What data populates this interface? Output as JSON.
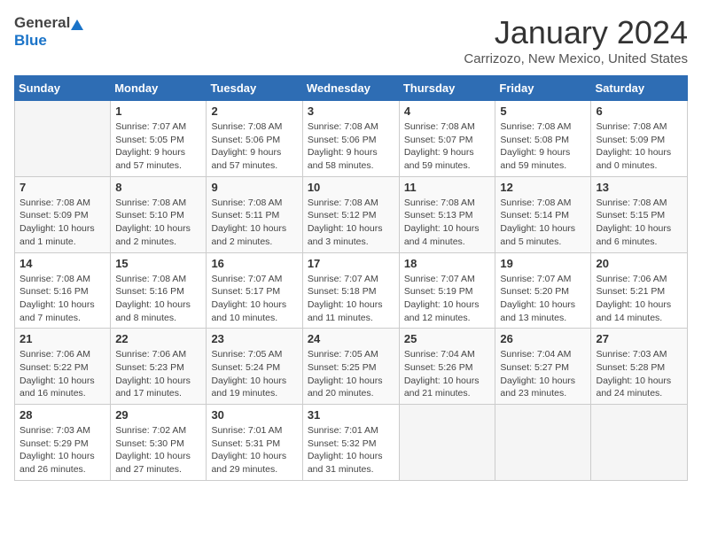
{
  "logo": {
    "general": "General",
    "blue": "Blue"
  },
  "header": {
    "month": "January 2024",
    "location": "Carrizozo, New Mexico, United States"
  },
  "days_of_week": [
    "Sunday",
    "Monday",
    "Tuesday",
    "Wednesday",
    "Thursday",
    "Friday",
    "Saturday"
  ],
  "weeks": [
    [
      {
        "num": "",
        "sunrise": "",
        "sunset": "",
        "daylight": ""
      },
      {
        "num": "1",
        "sunrise": "Sunrise: 7:07 AM",
        "sunset": "Sunset: 5:05 PM",
        "daylight": "Daylight: 9 hours and 57 minutes."
      },
      {
        "num": "2",
        "sunrise": "Sunrise: 7:08 AM",
        "sunset": "Sunset: 5:06 PM",
        "daylight": "Daylight: 9 hours and 57 minutes."
      },
      {
        "num": "3",
        "sunrise": "Sunrise: 7:08 AM",
        "sunset": "Sunset: 5:06 PM",
        "daylight": "Daylight: 9 hours and 58 minutes."
      },
      {
        "num": "4",
        "sunrise": "Sunrise: 7:08 AM",
        "sunset": "Sunset: 5:07 PM",
        "daylight": "Daylight: 9 hours and 59 minutes."
      },
      {
        "num": "5",
        "sunrise": "Sunrise: 7:08 AM",
        "sunset": "Sunset: 5:08 PM",
        "daylight": "Daylight: 9 hours and 59 minutes."
      },
      {
        "num": "6",
        "sunrise": "Sunrise: 7:08 AM",
        "sunset": "Sunset: 5:09 PM",
        "daylight": "Daylight: 10 hours and 0 minutes."
      }
    ],
    [
      {
        "num": "7",
        "sunrise": "Sunrise: 7:08 AM",
        "sunset": "Sunset: 5:09 PM",
        "daylight": "Daylight: 10 hours and 1 minute."
      },
      {
        "num": "8",
        "sunrise": "Sunrise: 7:08 AM",
        "sunset": "Sunset: 5:10 PM",
        "daylight": "Daylight: 10 hours and 2 minutes."
      },
      {
        "num": "9",
        "sunrise": "Sunrise: 7:08 AM",
        "sunset": "Sunset: 5:11 PM",
        "daylight": "Daylight: 10 hours and 2 minutes."
      },
      {
        "num": "10",
        "sunrise": "Sunrise: 7:08 AM",
        "sunset": "Sunset: 5:12 PM",
        "daylight": "Daylight: 10 hours and 3 minutes."
      },
      {
        "num": "11",
        "sunrise": "Sunrise: 7:08 AM",
        "sunset": "Sunset: 5:13 PM",
        "daylight": "Daylight: 10 hours and 4 minutes."
      },
      {
        "num": "12",
        "sunrise": "Sunrise: 7:08 AM",
        "sunset": "Sunset: 5:14 PM",
        "daylight": "Daylight: 10 hours and 5 minutes."
      },
      {
        "num": "13",
        "sunrise": "Sunrise: 7:08 AM",
        "sunset": "Sunset: 5:15 PM",
        "daylight": "Daylight: 10 hours and 6 minutes."
      }
    ],
    [
      {
        "num": "14",
        "sunrise": "Sunrise: 7:08 AM",
        "sunset": "Sunset: 5:16 PM",
        "daylight": "Daylight: 10 hours and 7 minutes."
      },
      {
        "num": "15",
        "sunrise": "Sunrise: 7:08 AM",
        "sunset": "Sunset: 5:16 PM",
        "daylight": "Daylight: 10 hours and 8 minutes."
      },
      {
        "num": "16",
        "sunrise": "Sunrise: 7:07 AM",
        "sunset": "Sunset: 5:17 PM",
        "daylight": "Daylight: 10 hours and 10 minutes."
      },
      {
        "num": "17",
        "sunrise": "Sunrise: 7:07 AM",
        "sunset": "Sunset: 5:18 PM",
        "daylight": "Daylight: 10 hours and 11 minutes."
      },
      {
        "num": "18",
        "sunrise": "Sunrise: 7:07 AM",
        "sunset": "Sunset: 5:19 PM",
        "daylight": "Daylight: 10 hours and 12 minutes."
      },
      {
        "num": "19",
        "sunrise": "Sunrise: 7:07 AM",
        "sunset": "Sunset: 5:20 PM",
        "daylight": "Daylight: 10 hours and 13 minutes."
      },
      {
        "num": "20",
        "sunrise": "Sunrise: 7:06 AM",
        "sunset": "Sunset: 5:21 PM",
        "daylight": "Daylight: 10 hours and 14 minutes."
      }
    ],
    [
      {
        "num": "21",
        "sunrise": "Sunrise: 7:06 AM",
        "sunset": "Sunset: 5:22 PM",
        "daylight": "Daylight: 10 hours and 16 minutes."
      },
      {
        "num": "22",
        "sunrise": "Sunrise: 7:06 AM",
        "sunset": "Sunset: 5:23 PM",
        "daylight": "Daylight: 10 hours and 17 minutes."
      },
      {
        "num": "23",
        "sunrise": "Sunrise: 7:05 AM",
        "sunset": "Sunset: 5:24 PM",
        "daylight": "Daylight: 10 hours and 19 minutes."
      },
      {
        "num": "24",
        "sunrise": "Sunrise: 7:05 AM",
        "sunset": "Sunset: 5:25 PM",
        "daylight": "Daylight: 10 hours and 20 minutes."
      },
      {
        "num": "25",
        "sunrise": "Sunrise: 7:04 AM",
        "sunset": "Sunset: 5:26 PM",
        "daylight": "Daylight: 10 hours and 21 minutes."
      },
      {
        "num": "26",
        "sunrise": "Sunrise: 7:04 AM",
        "sunset": "Sunset: 5:27 PM",
        "daylight": "Daylight: 10 hours and 23 minutes."
      },
      {
        "num": "27",
        "sunrise": "Sunrise: 7:03 AM",
        "sunset": "Sunset: 5:28 PM",
        "daylight": "Daylight: 10 hours and 24 minutes."
      }
    ],
    [
      {
        "num": "28",
        "sunrise": "Sunrise: 7:03 AM",
        "sunset": "Sunset: 5:29 PM",
        "daylight": "Daylight: 10 hours and 26 minutes."
      },
      {
        "num": "29",
        "sunrise": "Sunrise: 7:02 AM",
        "sunset": "Sunset: 5:30 PM",
        "daylight": "Daylight: 10 hours and 27 minutes."
      },
      {
        "num": "30",
        "sunrise": "Sunrise: 7:01 AM",
        "sunset": "Sunset: 5:31 PM",
        "daylight": "Daylight: 10 hours and 29 minutes."
      },
      {
        "num": "31",
        "sunrise": "Sunrise: 7:01 AM",
        "sunset": "Sunset: 5:32 PM",
        "daylight": "Daylight: 10 hours and 31 minutes."
      },
      {
        "num": "",
        "sunrise": "",
        "sunset": "",
        "daylight": ""
      },
      {
        "num": "",
        "sunrise": "",
        "sunset": "",
        "daylight": ""
      },
      {
        "num": "",
        "sunrise": "",
        "sunset": "",
        "daylight": ""
      }
    ]
  ]
}
